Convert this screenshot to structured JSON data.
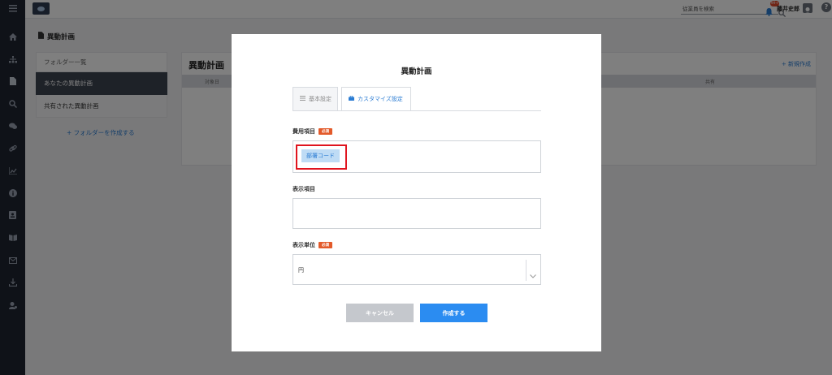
{
  "header": {
    "search_placeholder": "従業員を検索",
    "notification_count": "99+",
    "user_name": "藤井史郎",
    "help_label": "?"
  },
  "page": {
    "title": "異動計画"
  },
  "folders": {
    "heading": "フォルダー一覧",
    "items": [
      {
        "label": "あなたの異動計画",
        "active": true
      },
      {
        "label": "共有された異動計画",
        "active": false
      }
    ],
    "create_label": "+ フォルダーを作成する"
  },
  "list": {
    "title": "異動計画",
    "new_label": "+ 新規作成",
    "columns": [
      "対象日",
      "共有"
    ]
  },
  "modal": {
    "title": "異動計画",
    "tabs": [
      {
        "label": "基本設定",
        "active": false
      },
      {
        "label": "カスタマイズ設定",
        "active": true
      }
    ],
    "fields": {
      "cost_item": {
        "label": "費用項目",
        "required_badge": "必須",
        "chips": [
          "部署コード"
        ]
      },
      "display_item": {
        "label": "表示項目"
      },
      "display_unit": {
        "label": "表示単位",
        "required_badge": "必須",
        "value": "円"
      }
    },
    "buttons": {
      "cancel": "キャンセル",
      "create": "作成する"
    }
  },
  "colors": {
    "sidebar_bg": "#1e2431",
    "accent_blue": "#2b8cf1",
    "required_badge": "#e35a2a",
    "highlight_red": "#e0141e",
    "chip_bg": "#bfdcf5"
  }
}
